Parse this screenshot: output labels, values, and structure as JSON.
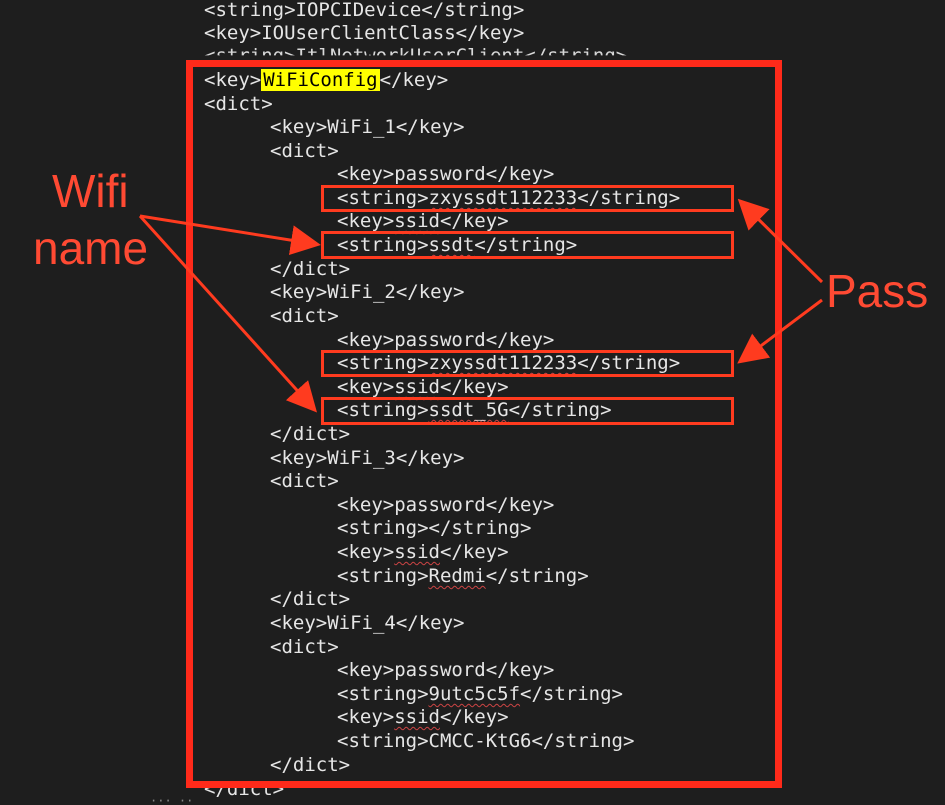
{
  "code": {
    "line_01": "<string>IOPCIDevice</string>",
    "line_02": "<key>IOUserClientClass</key>",
    "line_03": "<string>ItlNetworkUserClient</string>",
    "line_04_open": "<key>",
    "line_04_highlight": "WiFiConfig",
    "line_04_close": "</key>",
    "line_05": "<dict>",
    "wifi_entries": [
      {
        "key_line": "<key>WiFi_1</key>",
        "dict_open": "<dict>",
        "password_key": "<key>password</key>",
        "password_open": "<string>",
        "password_value": "zxyssdt112233",
        "password_close": "</string>",
        "ssid_key_open": "<key>",
        "ssid_key_name": "ssid",
        "ssid_key_close": "</key>",
        "ssid_open": "<string>",
        "ssid_value": "ssdt",
        "ssid_close": "</string>",
        "dict_close": "</dict>"
      },
      {
        "key_line": "<key>WiFi_2</key>",
        "dict_open": "<dict>",
        "password_key": "<key>password</key>",
        "password_open": "<string>",
        "password_value": "zxyssdt112233",
        "password_close": "</string>",
        "ssid_key_open": "<key>",
        "ssid_key_name": "ssid",
        "ssid_key_close": "</key>",
        "ssid_open": "<string>",
        "ssid_value": "ssdt_5G",
        "ssid_close": "</string>",
        "dict_close": "</dict>"
      },
      {
        "key_line": "<key>WiFi_3</key>",
        "dict_open": "<dict>",
        "password_key": "<key>password</key>",
        "password_open": "<string>",
        "password_value": "",
        "password_close": "</string>",
        "ssid_key_open": "<key>",
        "ssid_key_name": "ssid",
        "ssid_key_close": "</key>",
        "ssid_open": "<string>",
        "ssid_value": "Redmi",
        "ssid_close": "</string>",
        "dict_close": "</dict>"
      },
      {
        "key_line": "<key>WiFi_4</key>",
        "dict_open": "<dict>",
        "password_key": "<key>password</key>",
        "password_open": "<string>",
        "password_value": "9utc5c5f",
        "password_close": "</string>",
        "ssid_key_open": "<key>",
        "ssid_key_name": "ssid",
        "ssid_key_close": "</key>",
        "ssid_open": "<string>",
        "ssid_value": "CMCC-KtG6",
        "ssid_close": "</string>",
        "dict_close": "</dict>"
      }
    ],
    "final_line": "</dict>"
  },
  "annotations": {
    "wifi_label_line1": "Wifi",
    "wifi_label_line2": "name",
    "pass_label": "Pass"
  },
  "colors": {
    "background": "#1e1e1e",
    "code_text": "#e6e6e6",
    "annotation_red": "#ff2a1a",
    "highlight_yellow": "#ffff00"
  }
}
